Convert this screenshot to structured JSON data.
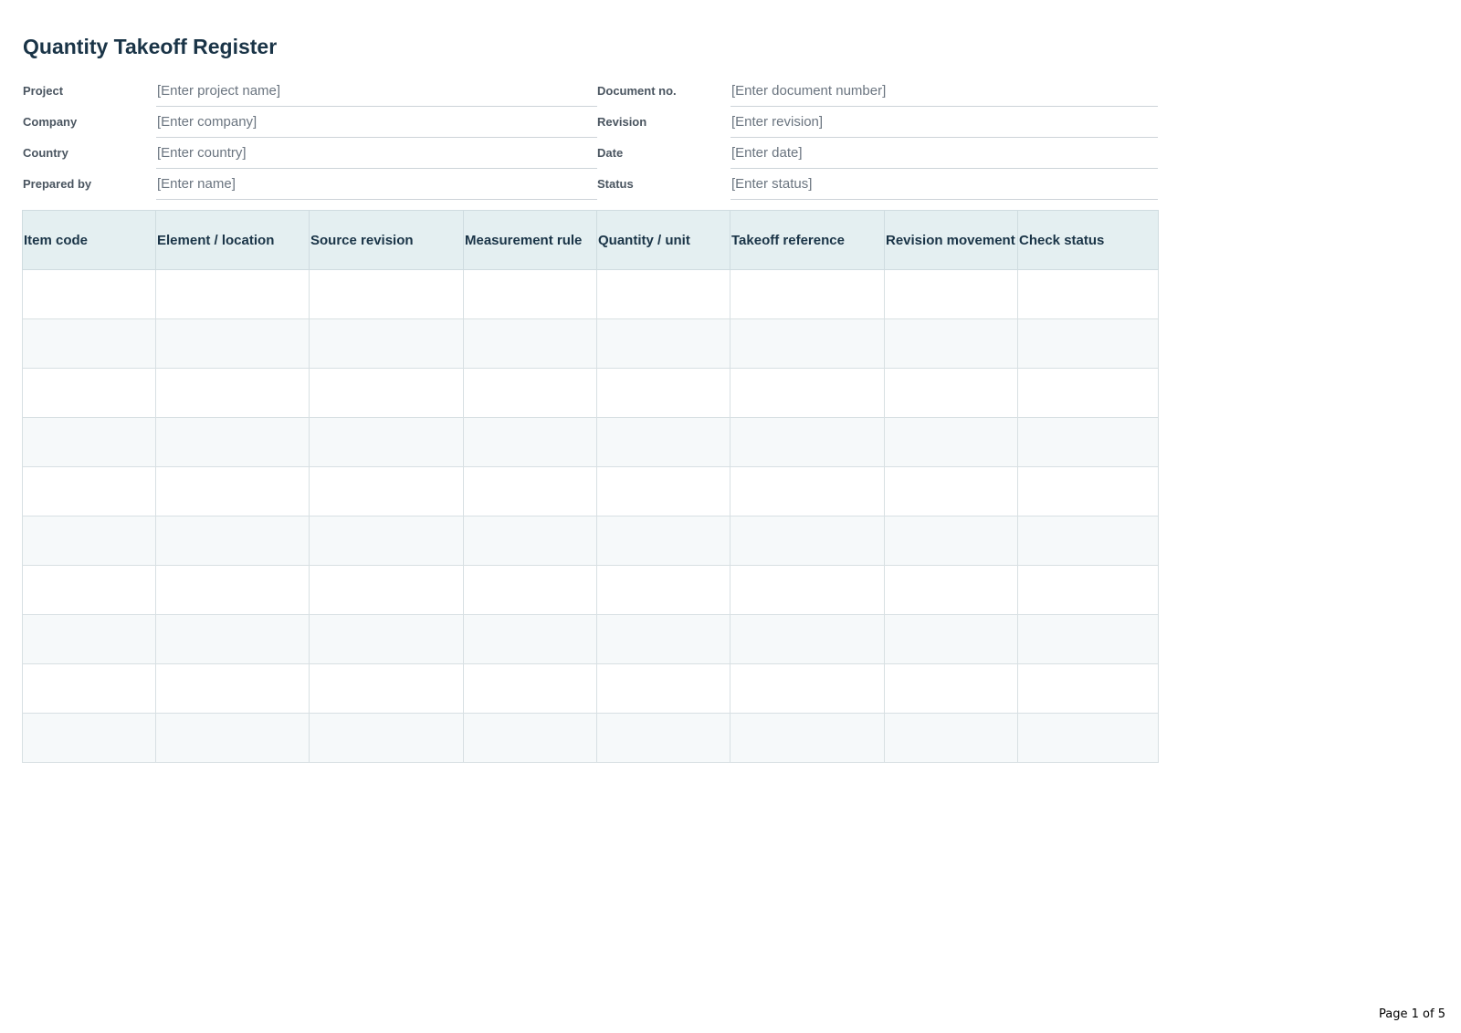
{
  "document": {
    "title": "Quantity Takeoff Register",
    "page_label": "Page 1 of 5"
  },
  "meta_fields": [
    {
      "left_label": "Project",
      "left_value": "[Enter project name]",
      "right_label": "Document no.",
      "right_value": "[Enter document number]"
    },
    {
      "left_label": "Company",
      "left_value": "[Enter company]",
      "right_label": "Revision",
      "right_value": "[Enter revision]"
    },
    {
      "left_label": "Country",
      "left_value": "[Enter country]",
      "right_label": "Date",
      "right_value": "[Enter date]"
    },
    {
      "left_label": "Prepared by",
      "left_value": "[Enter name]",
      "right_label": "Status",
      "right_value": "[Enter status]"
    }
  ],
  "register": {
    "columns": [
      "Item code",
      "Element / location",
      "Source revision",
      "Measurement rule",
      "Quantity / unit",
      "Takeoff reference",
      "Revision movement",
      "Check status"
    ],
    "rows": [
      [
        "",
        "",
        "",
        "",
        "",
        "",
        "",
        ""
      ],
      [
        "",
        "",
        "",
        "",
        "",
        "",
        "",
        ""
      ],
      [
        "",
        "",
        "",
        "",
        "",
        "",
        "",
        ""
      ],
      [
        "",
        "",
        "",
        "",
        "",
        "",
        "",
        ""
      ],
      [
        "",
        "",
        "",
        "",
        "",
        "",
        "",
        ""
      ],
      [
        "",
        "",
        "",
        "",
        "",
        "",
        "",
        ""
      ],
      [
        "",
        "",
        "",
        "",
        "",
        "",
        "",
        ""
      ],
      [
        "",
        "",
        "",
        "",
        "",
        "",
        "",
        ""
      ],
      [
        "",
        "",
        "",
        "",
        "",
        "",
        "",
        ""
      ],
      [
        "",
        "",
        "",
        "",
        "",
        "",
        "",
        ""
      ]
    ]
  },
  "colors": {
    "title_text": "#1a3447",
    "header_background": "#e4eff1",
    "alternate_row_background": "#f6f9fa",
    "grid_border": "#d8e0e3"
  }
}
